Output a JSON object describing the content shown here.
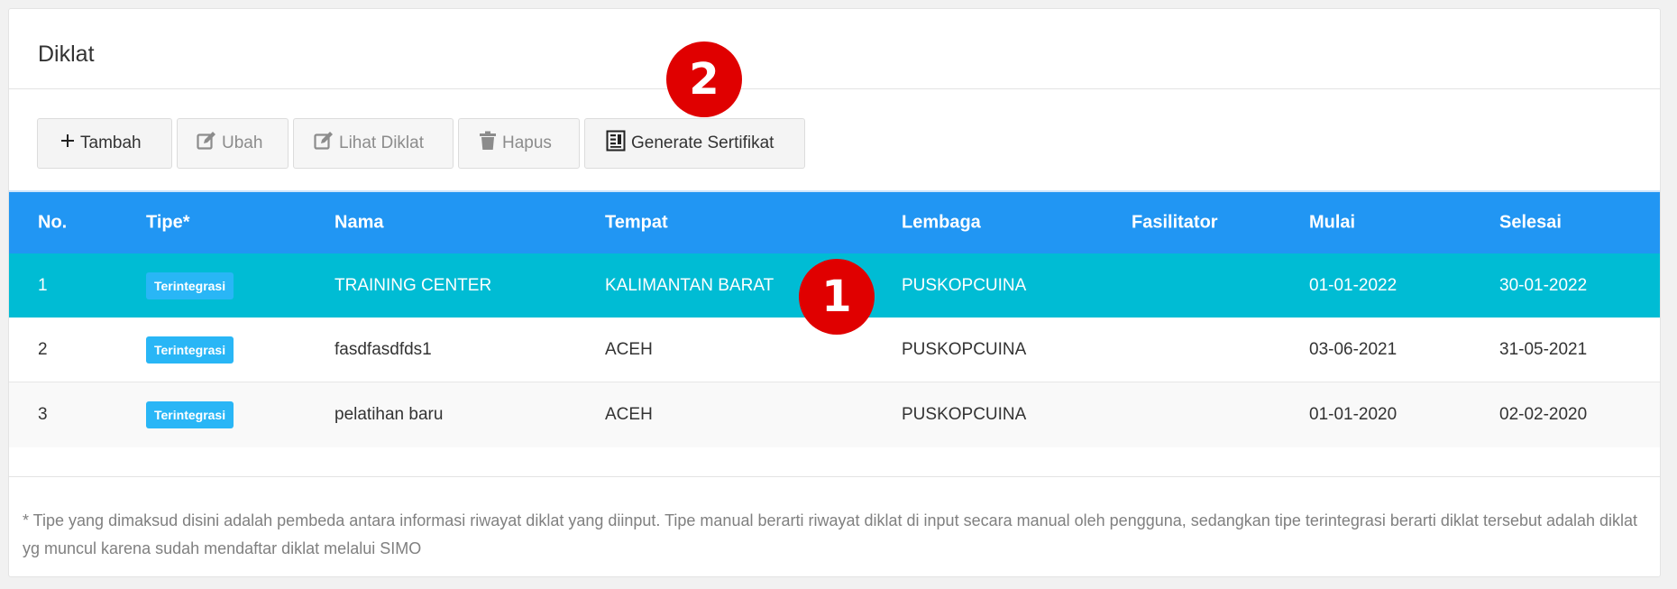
{
  "panel": {
    "title": "Diklat"
  },
  "toolbar": {
    "buttons": [
      {
        "label": "Tambah",
        "icon": "plus-icon",
        "enabled": true
      },
      {
        "label": "Ubah",
        "icon": "edit-icon",
        "enabled": false
      },
      {
        "label": "Lihat Diklat",
        "icon": "edit-icon",
        "enabled": false
      },
      {
        "label": "Hapus",
        "icon": "trash-icon",
        "enabled": false
      },
      {
        "label": "Generate Sertifikat",
        "icon": "certificate-icon",
        "enabled": true
      }
    ]
  },
  "table": {
    "headers": [
      "No.",
      "Tipe*",
      "Nama",
      "Tempat",
      "Lembaga",
      "Fasilitator",
      "Mulai",
      "Selesai"
    ],
    "rows": [
      {
        "no": "1",
        "tipe": "Terintegrasi",
        "nama": "TRAINING CENTER",
        "tempat": "KALIMANTAN BARAT",
        "lembaga": "PUSKOPCUINA",
        "fasilitator": "",
        "mulai": "01-01-2022",
        "selesai": "30-01-2022"
      },
      {
        "no": "2",
        "tipe": "Terintegrasi",
        "nama": "fasdfasdfds1",
        "tempat": "ACEH",
        "lembaga": "PUSKOPCUINA",
        "fasilitator": "",
        "mulai": "03-06-2021",
        "selesai": "31-05-2021"
      },
      {
        "no": "3",
        "tipe": "Terintegrasi",
        "nama": "pelatihan baru",
        "tempat": "ACEH",
        "lembaga": "PUSKOPCUINA",
        "fasilitator": "",
        "mulai": "01-01-2020",
        "selesai": "02-02-2020"
      }
    ]
  },
  "note": "* Tipe yang dimaksud disini adalah pembeda antara informasi riwayat diklat yang diinput. Tipe manual berarti riwayat diklat di input secara manual oleh pengguna, sedangkan tipe terintegrasi berarti diklat tersebut adalah diklat yg muncul karena sudah mendaftar diklat melalui SIMO",
  "markers": [
    "1",
    "2"
  ],
  "colors": {
    "header": "#2196f3",
    "active_row": "#00bcd4",
    "badge": "#29b6f6",
    "marker": "#e00000"
  }
}
